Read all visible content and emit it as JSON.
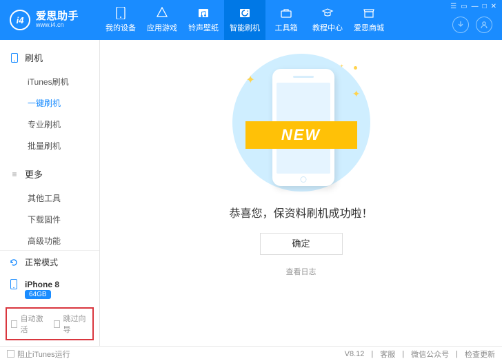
{
  "brand": {
    "name": "爱思助手",
    "url": "www.i4.cn",
    "logo_text": "i4"
  },
  "win_controls": [
    "☰",
    "▭",
    "—",
    "□",
    "✕"
  ],
  "nav": [
    {
      "icon": "phone",
      "label": "我的设备"
    },
    {
      "icon": "apps",
      "label": "应用游戏"
    },
    {
      "icon": "ringtone",
      "label": "铃声壁纸"
    },
    {
      "icon": "flash",
      "label": "智能刷机",
      "active": true
    },
    {
      "icon": "toolbox",
      "label": "工具箱"
    },
    {
      "icon": "tutorial",
      "label": "教程中心"
    },
    {
      "icon": "store",
      "label": "爱思商城"
    }
  ],
  "right_buttons": [
    "download-icon",
    "user-icon"
  ],
  "sidebar": {
    "sections": [
      {
        "title": "刷机",
        "icon": "phone-icon",
        "items": [
          {
            "label": "iTunes刷机"
          },
          {
            "label": "一键刷机",
            "active": true
          },
          {
            "label": "专业刷机"
          },
          {
            "label": "批量刷机"
          }
        ]
      },
      {
        "title": "更多",
        "icon": "menu-icon",
        "items": [
          {
            "label": "其他工具"
          },
          {
            "label": "下载固件"
          },
          {
            "label": "高级功能"
          }
        ]
      }
    ],
    "mode": "正常模式",
    "device": "iPhone 8",
    "device_badge": "64GB",
    "checks": [
      "自动激活",
      "跳过向导"
    ]
  },
  "main": {
    "ribbon_text": "NEW",
    "message": "恭喜您，保资料刷机成功啦！",
    "ok_label": "确定",
    "view_log": "查看日志"
  },
  "footer": {
    "block_itunes": "阻止iTunes运行",
    "version": "V8.12",
    "links": [
      "客服",
      "微信公众号",
      "检查更新"
    ]
  }
}
